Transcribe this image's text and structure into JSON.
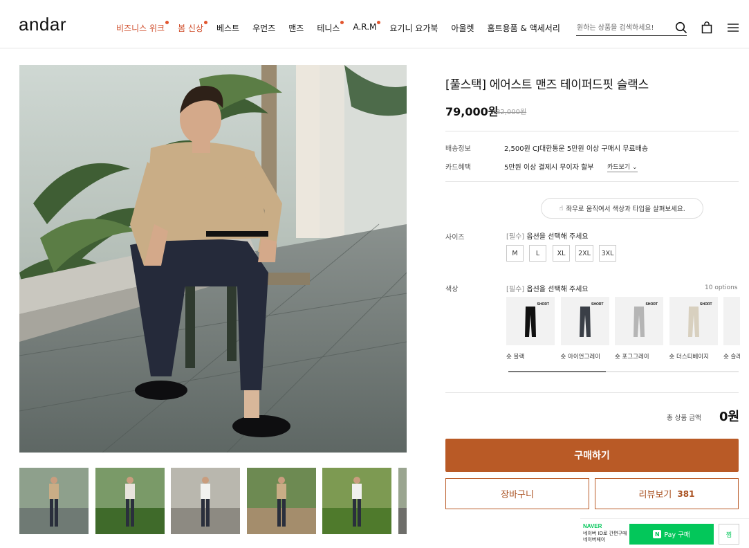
{
  "header": {
    "logo": "andar",
    "nav": [
      {
        "label": "비즈니스 위크",
        "red": true,
        "dot": true
      },
      {
        "label": "봄 신상",
        "red": true,
        "dot": true
      },
      {
        "label": "베스트",
        "red": false,
        "dot": false
      },
      {
        "label": "우먼즈",
        "red": false,
        "dot": false
      },
      {
        "label": "맨즈",
        "red": false,
        "dot": false
      },
      {
        "label": "테니스",
        "red": false,
        "dot": true
      },
      {
        "label": "A.R.M",
        "red": false,
        "dot": true
      },
      {
        "label": "요기니 요가북",
        "red": false,
        "dot": false
      },
      {
        "label": "아울렛",
        "red": false,
        "dot": false
      },
      {
        "label": "홈트용품 & 액세서리",
        "red": false,
        "dot": false
      }
    ],
    "search_placeholder": "원하는 상품을 검색하세요!",
    "icons": [
      "search-icon",
      "cart-icon",
      "menu-icon"
    ]
  },
  "product": {
    "title": "[풀스택] 에어스트 맨즈 테이퍼드핏 슬랙스",
    "price": "79,000원",
    "original_price": "82,000원",
    "shipping_label": "배송정보",
    "shipping_value": "2,500원  CJ대한통운 5만원 이상 구매시 무료배송",
    "card_label": "카드혜택",
    "card_value": "5만원 이상 결제시 무이자 할부",
    "card_link": "카드보기",
    "hint": "좌우로 움직여서 색상과 타입을 살펴보세요.",
    "size_label": "사이즈",
    "required": "[필수]",
    "size_prompt": "옵션을 선택해 주세요",
    "sizes": [
      "M",
      "L",
      "XL",
      "2XL",
      "3XL"
    ],
    "color_label": "색상",
    "color_prompt": "옵션을 선택해 주세요",
    "option_count": "10 options",
    "swatch_tag": "SHORT",
    "swatches": [
      {
        "name": "숏 블랙",
        "color": "#111111"
      },
      {
        "name": "숏 아이언그레이",
        "color": "#3a3f47"
      },
      {
        "name": "숏 포그그레이",
        "color": "#b5b5b5"
      },
      {
        "name": "숏 더스티베이지",
        "color": "#d8d0bf"
      },
      {
        "name": "숏 슬레",
        "color": "#8c8f93"
      }
    ],
    "total_label": "총 상품 금액",
    "total_value": "0원",
    "buy_label": "구매하기",
    "cart_label": "장바구니",
    "review_label": "리뷰보기",
    "review_count": "381"
  },
  "naver": {
    "brand": "NAVER",
    "sub": "네이버 ID로 간편구매 네이버페이",
    "pay_badge": "N",
    "pay_label": "Pay 구매",
    "zzim": "찜"
  },
  "colors": {
    "accent": "#b95a26",
    "nav_red": "#d0502e",
    "naver_green": "#03c75a"
  }
}
